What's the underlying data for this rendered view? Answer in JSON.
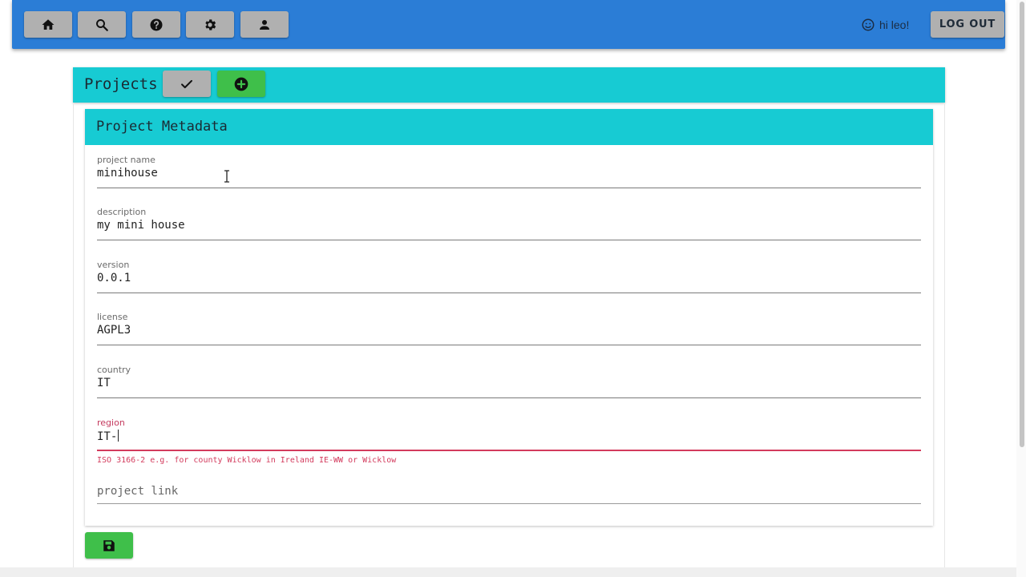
{
  "topbar": {
    "nav_icons": [
      "home-icon",
      "search-icon",
      "help-icon",
      "gear-icon",
      "user-icon"
    ],
    "greeting": "hi leo!",
    "greeting_icon": "smiley-icon",
    "logout_label": "LOG OUT",
    "color": "#2b7dd6"
  },
  "projects_bar": {
    "title": "Projects",
    "check_icon": "check-icon",
    "add_icon": "plus-circle-icon",
    "color": "#17cbd3"
  },
  "card": {
    "title": "Project Metadata",
    "fields": [
      {
        "label": "project name",
        "value": "minihouse"
      },
      {
        "label": "description",
        "value": "my mini house"
      },
      {
        "label": "version",
        "value": "0.0.1"
      },
      {
        "label": "license",
        "value": "AGPL3"
      },
      {
        "label": "country",
        "value": "IT"
      },
      {
        "label": "region",
        "value": "IT-",
        "error": true,
        "hint": "ISO 3166-2 e.g. for county Wicklow in Ireland IE-WW or Wicklow"
      }
    ],
    "link_field": {
      "placeholder": "project link"
    }
  },
  "save_icon": "floppy-disk-icon",
  "colors": {
    "error": "#d33b5d",
    "success": "#3fbf4a",
    "button_grey": "#b0b0b0"
  }
}
